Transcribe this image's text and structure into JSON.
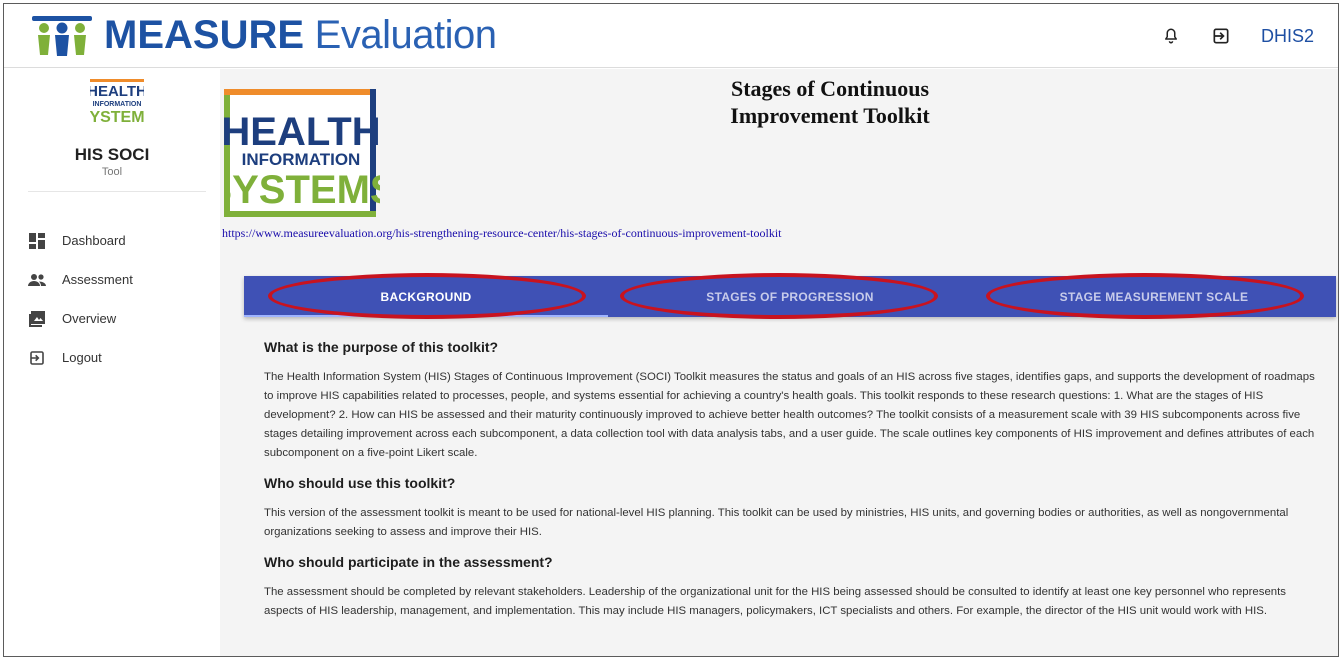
{
  "header": {
    "brand_bold": "MEASURE",
    "brand_light": " Evaluation",
    "bell_icon": "bell-icon",
    "logout_icon": "logout-icon",
    "app_name": "DHIS2"
  },
  "sidebar": {
    "logo_lines": [
      "HEALTH",
      "INFORMATION",
      "SYSTEMS"
    ],
    "title": "HIS SOCI",
    "subtitle": "Tool",
    "items": [
      {
        "label": "Dashboard",
        "icon": "dashboard-icon"
      },
      {
        "label": "Assessment",
        "icon": "people-icon"
      },
      {
        "label": "Overview",
        "icon": "image-icon"
      },
      {
        "label": "Logout",
        "icon": "logout-icon"
      }
    ]
  },
  "main": {
    "logo_lines": [
      "HEALTH",
      "INFORMATION",
      "SYSTEMS"
    ],
    "title_line1": "Stages of Continuous",
    "title_line2": "Improvement Toolkit",
    "link": "https://www.measureevaluation.org/his-strengthening-resource-center/his-stages-of-continuous-improvement-toolkit",
    "tabs": [
      {
        "label": "BACKGROUND",
        "active": true
      },
      {
        "label": "STAGES OF PROGRESSION",
        "active": false
      },
      {
        "label": "STAGE MEASUREMENT SCALE",
        "active": false
      }
    ],
    "sections": [
      {
        "heading": "What is the purpose of this toolkit?",
        "body": "The Health Information System (HIS) Stages of Continuous Improvement (SOCI) Toolkit measures the status and goals of an HIS across five stages, identifies gaps, and supports the development of roadmaps to improve HIS capabilities related to processes, people, and systems essential for achieving a country's health goals. This toolkit responds to these research questions: 1. What are the stages of HIS development? 2. How can HIS be assessed and their maturity continuously improved to achieve better health outcomes? The toolkit consists of a measurement scale with 39 HIS subcomponents across five stages detailing improvement across each subcomponent, a data collection tool with data analysis tabs, and a user guide. The scale outlines key components of HIS improvement and defines attributes of each subcomponent on a five-point Likert scale."
      },
      {
        "heading": "Who should use this toolkit?",
        "body": "This version of the assessment toolkit is meant to be used for national-level HIS planning. This toolkit can be used by ministries, HIS units, and governing bodies or authorities, as well as nongovernmental organizations seeking to assess and improve their HIS."
      },
      {
        "heading": "Who should participate in the assessment?",
        "body": "The assessment should be completed by relevant stakeholders. Leadership of the organizational unit for the HIS being assessed should be consulted to identify at least one key personnel who represents aspects of HIS leadership, management, and implementation. This may include HIS managers, policymakers, ICT specialists and others. For example, the director of the HIS unit would work with HIS."
      }
    ]
  },
  "colors": {
    "brand_blue": "#1d52a3",
    "tab_bar": "#3f51b5",
    "annotation_red": "#c8131f",
    "his_green": "#7fb03a",
    "his_orange": "#ef8c2b",
    "his_navy": "#1d3e7e"
  }
}
